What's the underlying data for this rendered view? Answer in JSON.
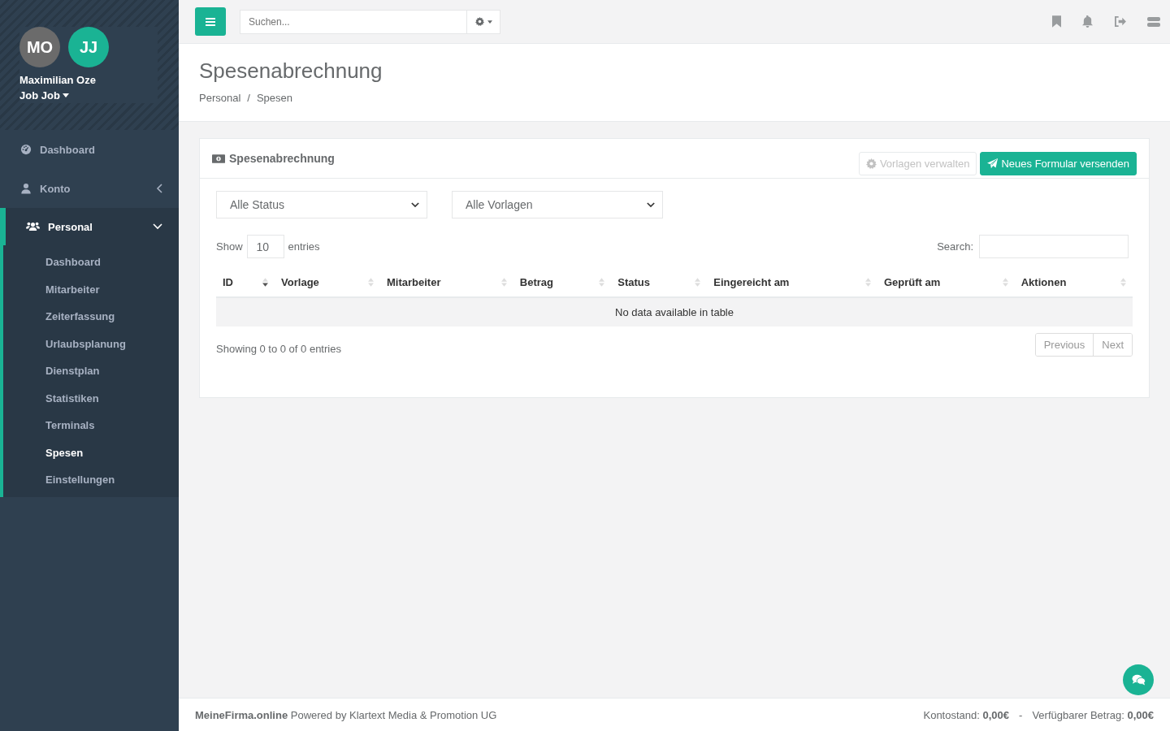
{
  "sidebar": {
    "user": {
      "avatars": [
        {
          "initials": "MO",
          "color": "#6b6b6b"
        },
        {
          "initials": "JJ",
          "color": "#1ab394"
        }
      ],
      "name": "Maximilian Oze",
      "role": "Job Job"
    },
    "items": [
      {
        "label": "Dashboard",
        "selected": false
      },
      {
        "label": "Konto",
        "expanded": false,
        "selected": false
      },
      {
        "label": "Personal",
        "expanded": true,
        "selected": true,
        "children": [
          {
            "label": "Dashboard",
            "selected": false
          },
          {
            "label": "Mitarbeiter",
            "selected": false
          },
          {
            "label": "Zeiterfassung",
            "selected": false
          },
          {
            "label": "Urlaubsplanung",
            "selected": false
          },
          {
            "label": "Dienstplan",
            "selected": false
          },
          {
            "label": "Statistiken",
            "selected": false
          },
          {
            "label": "Terminals",
            "selected": false
          },
          {
            "label": "Spesen",
            "selected": true
          },
          {
            "label": "Einstellungen",
            "selected": false
          }
        ]
      }
    ]
  },
  "topbar": {
    "search": {
      "placeholder": "Suchen..."
    }
  },
  "header": {
    "title": "Spesenabrechnung",
    "breadcrumb": [
      "Personal",
      "Spesen"
    ],
    "breadcrumb_separator": "/"
  },
  "panel": {
    "title": "Spesenabrechnung",
    "buttons": [
      {
        "label": "Vorlagen verwalten",
        "kind": "secondary"
      },
      {
        "label": "Neues Formular versenden",
        "kind": "primary"
      }
    ],
    "filters": [
      {
        "value": "Alle Status"
      },
      {
        "value": "Alle Vorlagen"
      }
    ],
    "length": {
      "label_before": "Show",
      "value": "10",
      "label_after": "entries"
    },
    "search": {
      "label": "Search:"
    },
    "table": {
      "columns": [
        {
          "label": "ID",
          "sorted": true
        },
        {
          "label": "Vorlage",
          "sorted": false
        },
        {
          "label": "Mitarbeiter",
          "sorted": false
        },
        {
          "label": "Betrag",
          "sorted": false
        },
        {
          "label": "Status",
          "sorted": false
        },
        {
          "label": "Eingereicht am",
          "sorted": false
        },
        {
          "label": "Geprüft am",
          "sorted": false
        },
        {
          "label": "Aktionen",
          "sorted": false
        }
      ],
      "empty": "No data available in table"
    },
    "info": "Showing 0 to 0 of 0 entries",
    "pagination": [
      "Previous",
      "Next"
    ]
  },
  "footer": {
    "credit": "**MeineFirma.online** Powered by Klartext Media & Promotion UG",
    "balance": [
      "Kontostand: **0,00€**",
      "-",
      "Verfügbarer Betrag: **0,00€**"
    ]
  }
}
